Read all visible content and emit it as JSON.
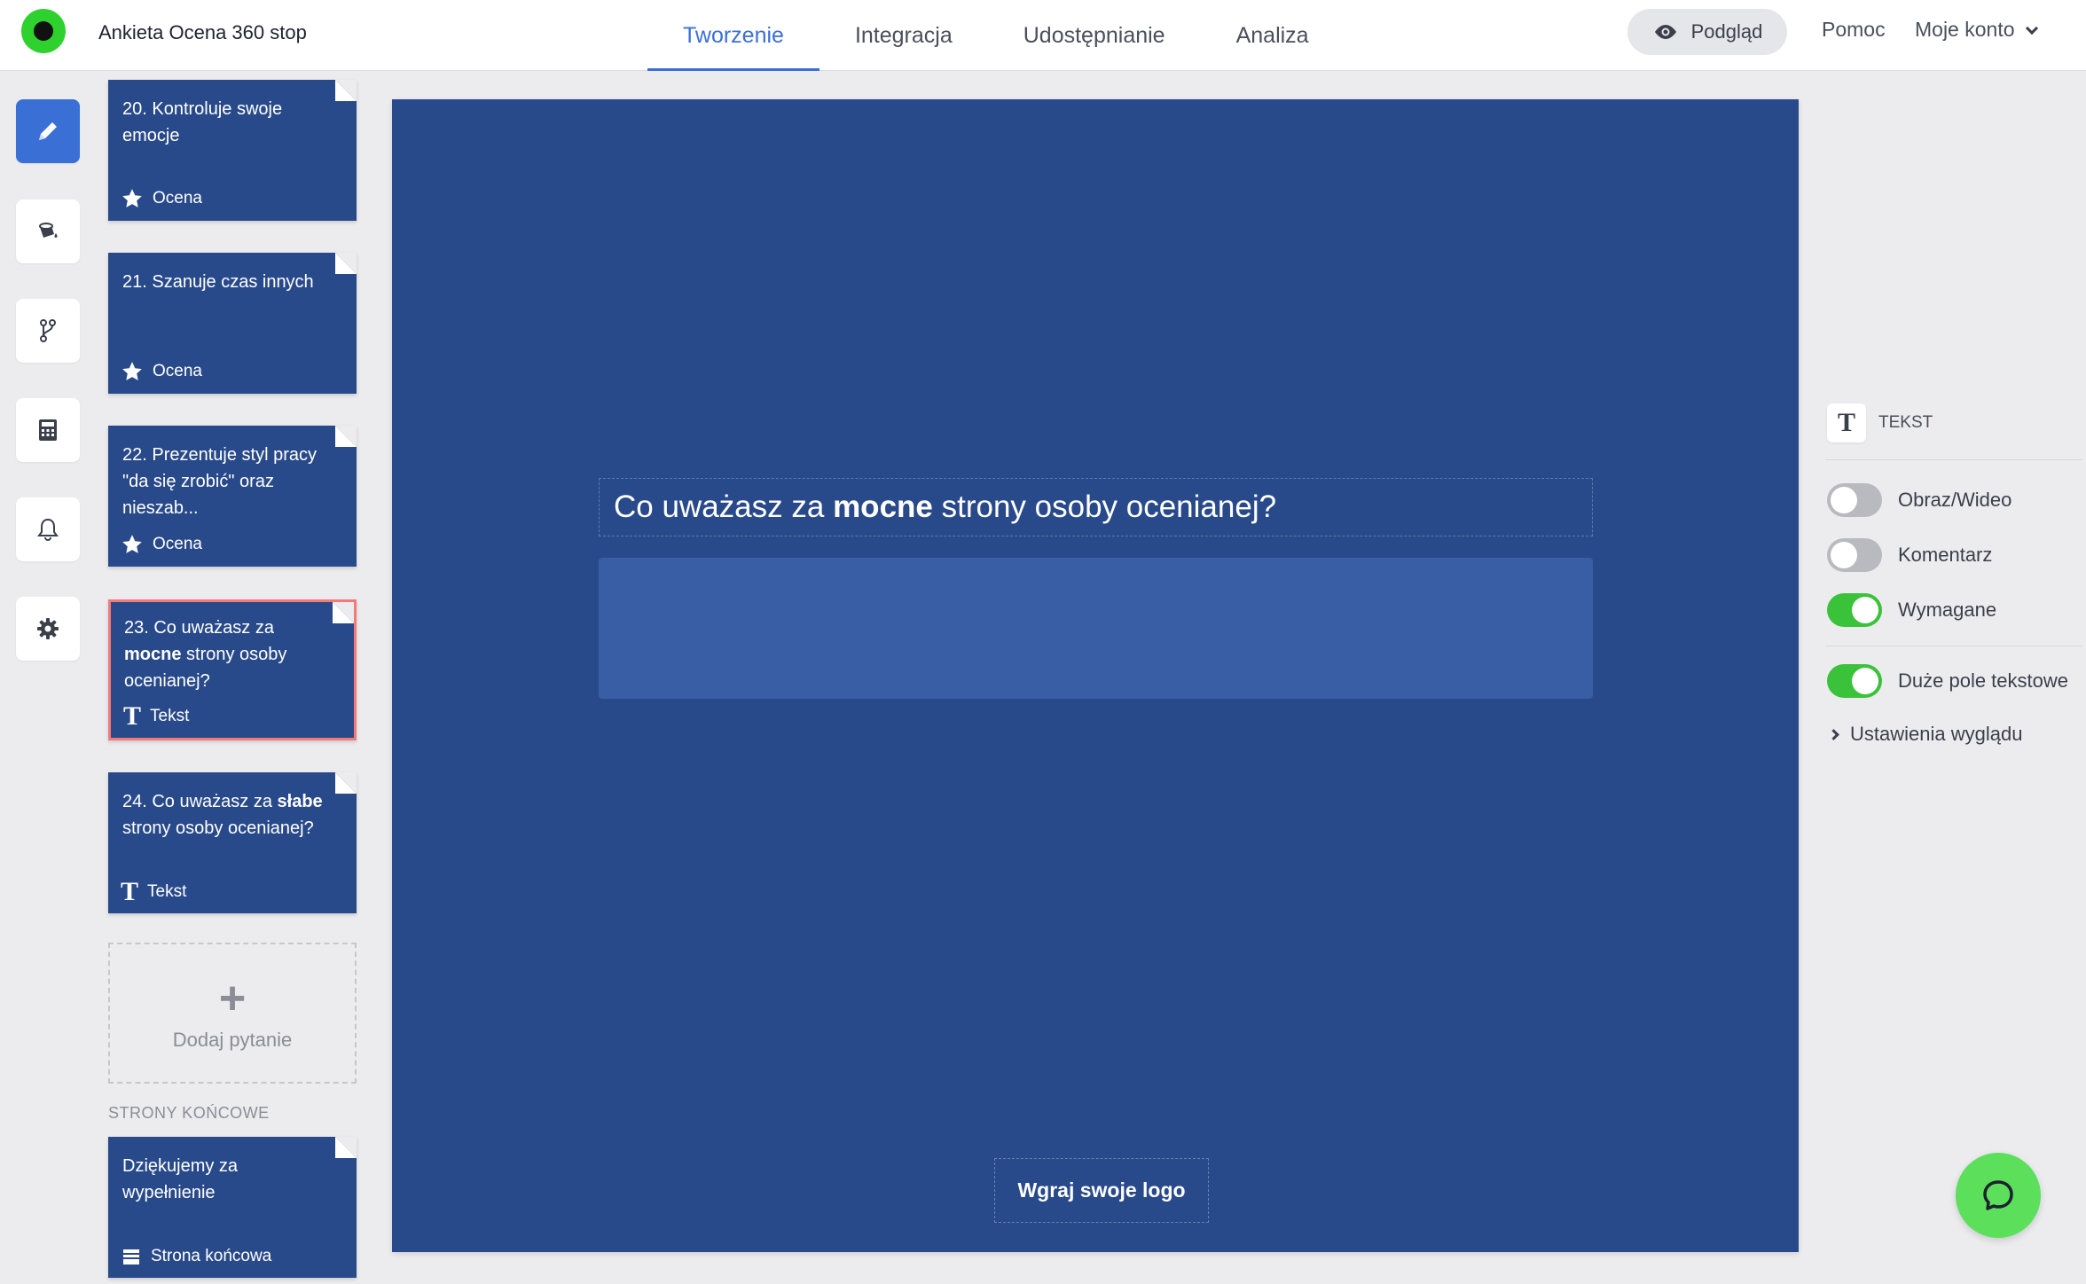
{
  "header": {
    "survey_title": "Ankieta Ocena 360 stop",
    "tabs": [
      {
        "label": "Tworzenie"
      },
      {
        "label": "Integracja"
      },
      {
        "label": "Udostępnianie"
      },
      {
        "label": "Analiza"
      }
    ],
    "preview_label": "Podgląd",
    "help_label": "Pomoc",
    "account_label": "Moje konto"
  },
  "questions": [
    {
      "text": "20. Kontroluje swoje emocje",
      "type": "Ocena"
    },
    {
      "text": "21. Szanuje czas innych",
      "type": "Ocena"
    },
    {
      "text": "22. Prezentuje styl pracy \"da się zrobić\" oraz nieszab...",
      "type": "Ocena"
    },
    {
      "prefix": "23. Co uważasz za ",
      "bold": "mocne",
      "suffix": " strony osoby ocenianej?",
      "type": "Tekst"
    },
    {
      "prefix": "24. Co uważasz za ",
      "bold": "słabe",
      "suffix": " strony osoby ocenianej?",
      "type": "Tekst"
    }
  ],
  "add_question_label": "Dodaj pytanie",
  "end_pages_label": "STRONY KOŃCOWE",
  "end_page": {
    "text": "Dziękujemy za wypełnienie",
    "type": "Strona końcowa"
  },
  "canvas": {
    "question_prefix": "Co uważasz za ",
    "question_bold": "mocne",
    "question_suffix": " strony osoby ocenianej?",
    "upload_logo_label": "Wgraj swoje logo",
    "background_color": "#294a8a"
  },
  "panel": {
    "type_label": "TEKST",
    "options": [
      {
        "label": "Obraz/Wideo",
        "on": false
      },
      {
        "label": "Komentarz",
        "on": false
      },
      {
        "label": "Wymagane",
        "on": true
      },
      {
        "label": "Duże pole tekstowe",
        "on": true
      }
    ],
    "appearance_label": "Ustawienia wyglądu"
  },
  "colors": {
    "accent": "#3a6fd6",
    "toggle_on": "#3ac23a",
    "selected_border": "#f47a7a"
  }
}
